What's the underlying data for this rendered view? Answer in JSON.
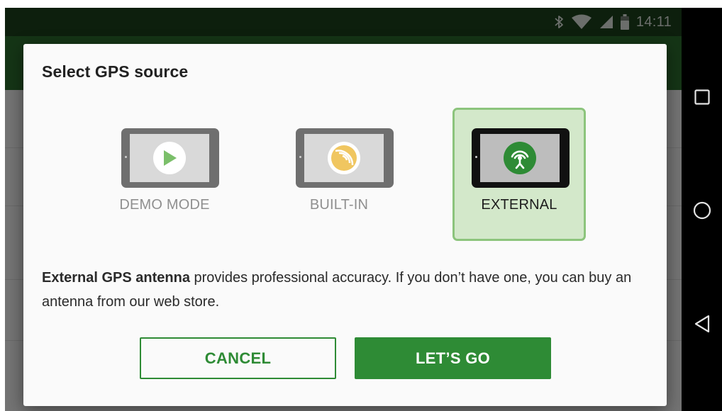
{
  "status_bar": {
    "time": "14:11",
    "icons": [
      "bluetooth-icon",
      "wifi-icon",
      "cell-signal-icon",
      "battery-icon"
    ]
  },
  "dialog": {
    "title": "Select GPS source",
    "options": [
      {
        "label": "DEMO MODE",
        "icon": "play-icon",
        "selected": false
      },
      {
        "label": "BUILT-IN",
        "icon": "satellite-dish-icon",
        "selected": false
      },
      {
        "label": "EXTERNAL",
        "icon": "antenna-icon",
        "selected": true
      }
    ],
    "description": {
      "bold": "External GPS antenna",
      "rest": " provides professional accuracy. If you don’t have one, you can buy an antenna from our web store."
    },
    "cancel_label": "CANCEL",
    "confirm_label": "LET’S GO"
  },
  "nav_bar": {
    "buttons": [
      "recents-icon",
      "home-icon",
      "back-icon"
    ]
  },
  "colors": {
    "status_bar": "#1a3e1b",
    "app_bar": "#2a6b2c",
    "accent": "#2e8b35",
    "selected_bg": "#d3e8ca",
    "selected_border": "#8cc47c",
    "play_green": "#7bbf6a",
    "builtin_yellow": "#f0c660"
  }
}
